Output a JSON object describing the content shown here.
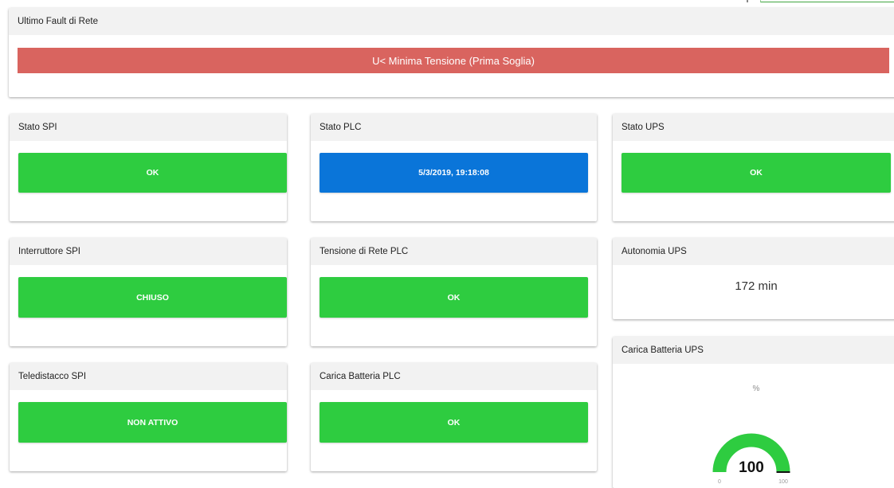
{
  "colors": {
    "ok_green": "#2ecc40",
    "plc_blue": "#0a75d9",
    "fault_red": "#d9645f",
    "gauge_track": "#e6e6e6",
    "header_bg": "#f2f2f2"
  },
  "fault": {
    "title": "Ultimo Fault di Rete",
    "message": "U< Minima Tensione (Prima Soglia)"
  },
  "spi": {
    "stato": {
      "title": "Stato SPI",
      "value": "OK"
    },
    "interruttore": {
      "title": "Interruttore SPI",
      "value": "CHIUSO"
    },
    "teledistacco": {
      "title": "Teledistacco SPI",
      "value": "NON ATTIVO"
    }
  },
  "plc": {
    "stato": {
      "title": "Stato PLC",
      "value": "5/3/2019, 19:18:08"
    },
    "tensione": {
      "title": "Tensione di Rete PLC",
      "value": "OK"
    },
    "batteria": {
      "title": "Carica Batteria PLC",
      "value": "OK"
    }
  },
  "ups": {
    "stato": {
      "title": "Stato UPS",
      "value": "OK"
    },
    "autonomia": {
      "title": "Autonomia UPS",
      "value": "172 min"
    },
    "batteria": {
      "title": "Carica Batteria UPS",
      "unit": "%",
      "value": 100,
      "value_label": "100",
      "min": 0,
      "max": 100,
      "min_label": "0",
      "max_label": "100"
    }
  }
}
